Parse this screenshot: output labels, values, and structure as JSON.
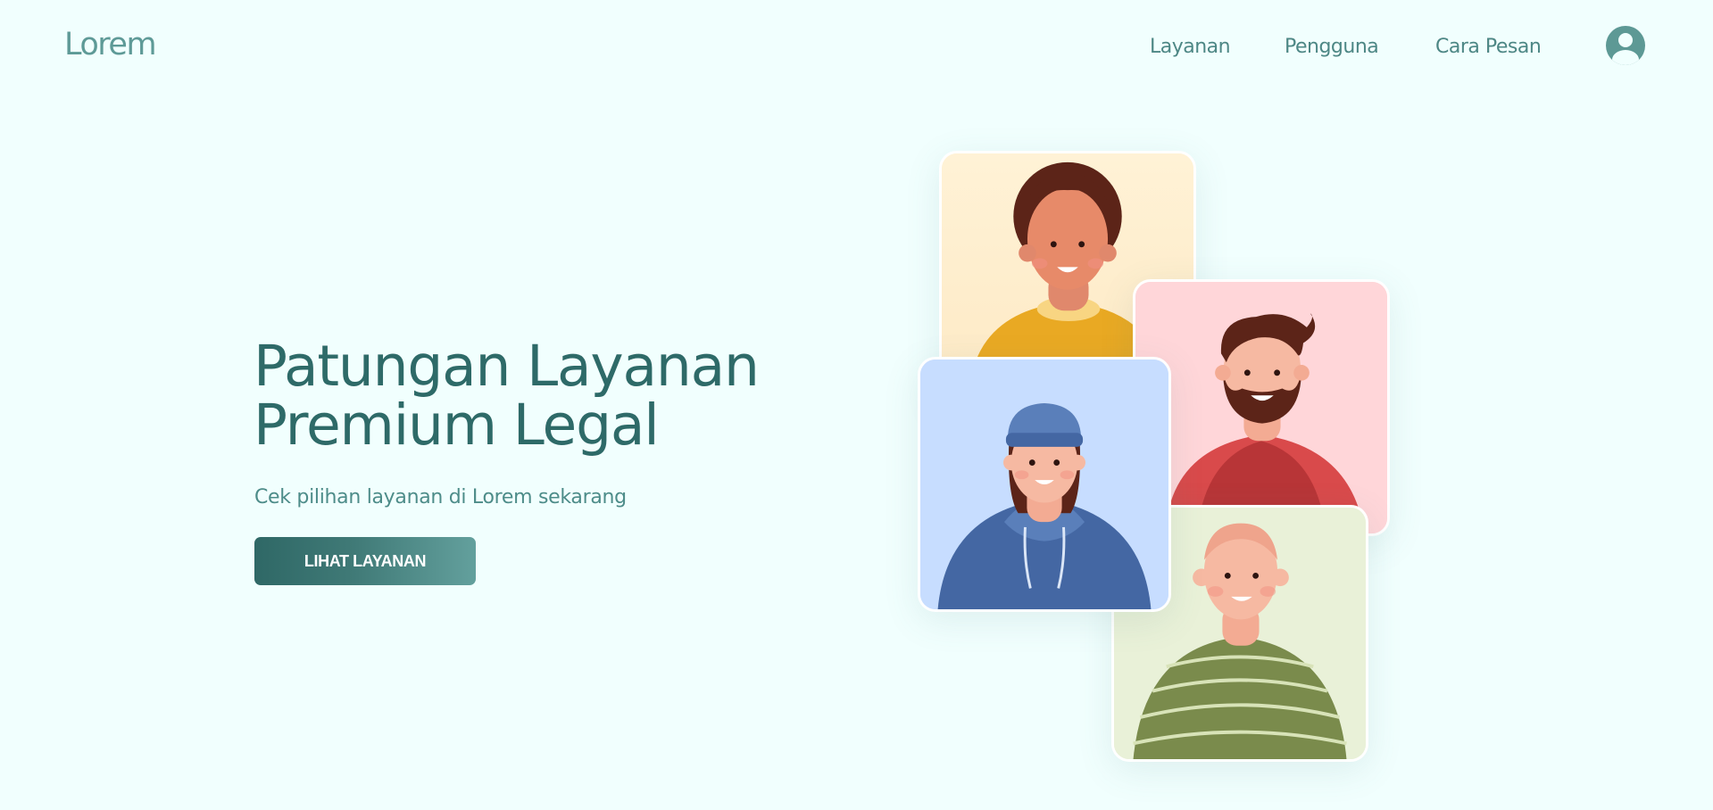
{
  "nav": {
    "logo": "Lorem",
    "links": [
      "Layanan",
      "Pengguna",
      "Cara Pesan"
    ],
    "profile_icon": "user-circle-icon"
  },
  "hero": {
    "title_line1": "Patungan Layanan",
    "title_line2": "Premium Legal",
    "subtitle": "Cek pilihan layanan di Lorem sekarang",
    "cta_label": "LIHAT LAYANAN"
  },
  "illustration": {
    "cards": [
      {
        "name": "yellow-card",
        "background": "#fff2d6"
      },
      {
        "name": "pink-card",
        "background": "#ffd6d9"
      },
      {
        "name": "blue-card",
        "background": "#c7ddff"
      },
      {
        "name": "green-card",
        "background": "#e9f1d8"
      }
    ]
  },
  "colors": {
    "background": "#f1fffe",
    "brand_dark": "#2e6a68",
    "brand_light": "#5e9a97"
  }
}
